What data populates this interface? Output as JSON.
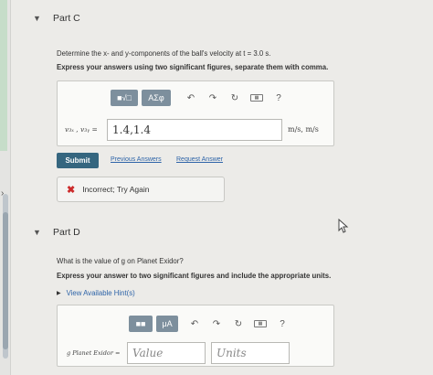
{
  "partC": {
    "title": "Part C",
    "question": "Determine the x- and y-components of the ball's velocity at t = 3.0 s.",
    "instruction": "Express your answers using two significant figures, separate them with comma.",
    "toolbar": {
      "math_btn": "■√□",
      "greek_btn": "ΑΣφ",
      "help": "?"
    },
    "answer_label": "v₃ₓ , v₃ᵧ =",
    "answer_value": "1.4,1.4",
    "units": "m/s, m/s",
    "submit": "Submit",
    "previous_answers": "Previous Answers",
    "request_answer": "Request Answer",
    "feedback": "Incorrect; Try Again"
  },
  "partD": {
    "title": "Part D",
    "question": "What is the value of g on Planet Exidor?",
    "instruction": "Express your answer to two significant figures and include the appropriate units.",
    "hints": "View Available Hint(s)",
    "toolbar": {
      "math_btn": "■■",
      "mu_btn": "μA",
      "help": "?"
    },
    "answer_label": "g Planet Exidor =",
    "value_placeholder": "Value",
    "units_placeholder": "Units"
  },
  "colors": {
    "accent": "#35667f",
    "link": "#2e64a8",
    "error": "#cc2b2b"
  }
}
